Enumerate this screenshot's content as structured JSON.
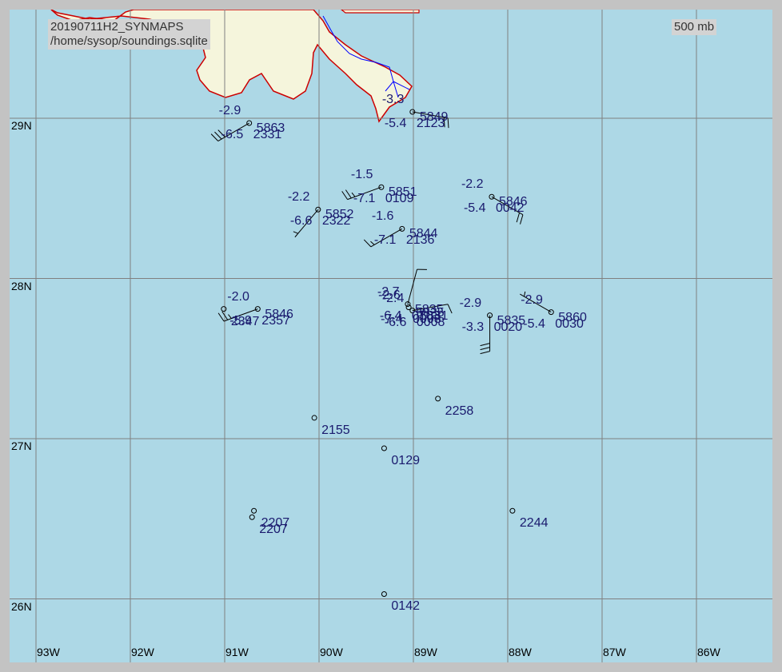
{
  "header": {
    "title": "20190711H2_SYNMAPS",
    "path": "/home/sysop/soundings.sqlite",
    "level": "500 mb"
  },
  "colors": {
    "ocean": "#add8e6",
    "land": "#f5f5dc",
    "coast": "#cc0000",
    "river": "#0000ff",
    "grid": "#808080",
    "text": "#1a1a6e"
  },
  "lat_labels": [
    "29N",
    "28N",
    "27N",
    "26N"
  ],
  "lon_labels": [
    "93W",
    "92W",
    "91W",
    "90W",
    "89W",
    "88W",
    "87W",
    "86W"
  ],
  "stations": [
    {
      "lon": -90.74,
      "lat": 28.97,
      "t": "-2.9",
      "td": "-6.5",
      "h": "5863",
      "id": "2331",
      "dir": 240,
      "kt": 30
    },
    {
      "lon": -89.01,
      "lat": 29.04,
      "t": "-3.3",
      "td": "-5.4",
      "h": "5849",
      "id": "2123",
      "dir": 100,
      "kt": 20
    },
    {
      "lon": -90.01,
      "lat": 28.43,
      "t": "-2.2",
      "td": "-6.6",
      "h": "5852",
      "id": "2322",
      "dir": 220,
      "kt": 5
    },
    {
      "lon": -89.34,
      "lat": 28.57,
      "t": "-1.5",
      "td": "-7.1",
      "h": "5851",
      "id": "0109",
      "dir": 250,
      "kt": 25
    },
    {
      "lon": -88.17,
      "lat": 28.51,
      "t": "-2.2",
      "td": "-5.4",
      "h": "5846",
      "id": "0042",
      "dir": 120,
      "kt": 20
    },
    {
      "lon": -89.12,
      "lat": 28.31,
      "t": "-1.6",
      "td": "-7.1",
      "h": "5844",
      "id": "2136",
      "dir": 240,
      "kt": 15
    },
    {
      "lon": -90.65,
      "lat": 27.81,
      "t": "-2.0",
      "td": "-5.9",
      "h": "5846",
      "id": "2357",
      "dir": 250,
      "kt": 25
    },
    {
      "lon": -89.06,
      "lat": 27.84,
      "t": "-2.7",
      "td": "-6.4",
      "h": "5835",
      "id": "0103",
      "dir": 15,
      "kt": 10
    },
    {
      "lon": -89.05,
      "lat": 27.82,
      "t": "-2.6",
      "td": "-7.4",
      "h": "5835",
      "id": "0008",
      "dir": 0,
      "kt": 0
    },
    {
      "lon": -89.01,
      "lat": 27.8,
      "t": "-2.4",
      "td": "-6.6",
      "h": "5831",
      "id": "0008",
      "dir": 80,
      "kt": 10
    },
    {
      "lon": -88.19,
      "lat": 27.77,
      "t": "-2.9",
      "td": "-3.3",
      "h": "5835",
      "id": "0020",
      "dir": 180,
      "kt": 30
    },
    {
      "lon": -87.54,
      "lat": 27.79,
      "t": "-2.9",
      "td": "-5.4",
      "h": "5860",
      "id": "0030",
      "dir": 300,
      "kt": 5
    }
  ],
  "station_ids_only": [
    {
      "lon": -91.01,
      "lat": 27.81,
      "id": "2347"
    },
    {
      "lon": -88.74,
      "lat": 27.25,
      "id": "2258"
    },
    {
      "lon": -90.05,
      "lat": 27.13,
      "id": "2155"
    },
    {
      "lon": -89.31,
      "lat": 26.94,
      "id": "0129"
    },
    {
      "lon": -90.69,
      "lat": 26.55,
      "id": "2207"
    },
    {
      "lon": -90.71,
      "lat": 26.51,
      "id": "2207"
    },
    {
      "lon": -87.95,
      "lat": 26.55,
      "id": "2244"
    },
    {
      "lon": -89.31,
      "lat": 26.03,
      "id": "0142"
    }
  ]
}
